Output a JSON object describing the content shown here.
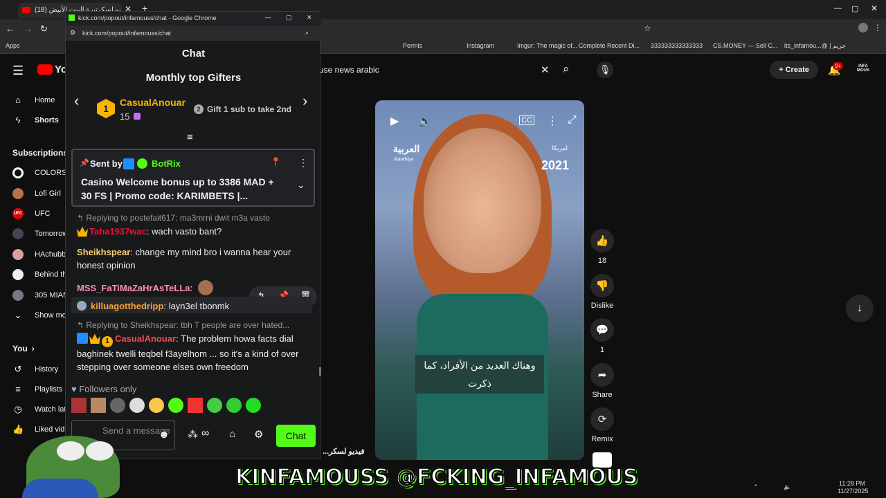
{
  "browser": {
    "tab_title": "(18) فيديو لسكرتيرة البيت الأبيض",
    "bookmarks": [
      "Apps",
      "Permis",
      "Instagram",
      "Imgur: The magic of...",
      "Complete Recent Di...",
      "333333333333333",
      "CS.MONEY — Sell C...",
      "its_infamou...@ | جريم"
    ]
  },
  "youtube": {
    "logo": "You",
    "search_value": "use news arabic",
    "create_label": "Create",
    "notif_count": "9+",
    "sidebar": {
      "top": [
        {
          "label": "Home",
          "icon": "home-icon"
        },
        {
          "label": "Shorts",
          "icon": "shorts-icon"
        }
      ],
      "subscriptions_title": "Subscriptions",
      "subscriptions": [
        "COLORS",
        "Lofi Girl",
        "UFC",
        "Tomorrow",
        "HAchubb",
        "Behind th",
        "305 MIAN",
        "Show mo"
      ],
      "you_title": "You",
      "you_items": [
        "History",
        "Playlists",
        "Watch lat",
        "Liked vid"
      ]
    },
    "video": {
      "brand": "العربية",
      "brand_sub": "alarabiya",
      "country": "امريكا",
      "year": "2021",
      "caption": "وهناك العديد من الأفراد، كما ذكرت",
      "bottom_title": "...فيديو لسكر"
    },
    "actions": {
      "likes": "18",
      "dislike": "Dislike",
      "comments": "1",
      "share": "Share",
      "remix": "Remix"
    }
  },
  "chat_window": {
    "window_title": "kick.com/popout/infamouss/chat - Google Chrome",
    "url": "kick.com/popout/infamouss/chat",
    "heading": "Chat",
    "gifters_title": "Monthly top Gifters",
    "top_gifter": {
      "rank": "1",
      "name": "CasualAnouar",
      "count": "15"
    },
    "second_hint": {
      "rank": "2",
      "text": "Gift 1 sub to take 2nd"
    },
    "pinned": {
      "sent_by": "Sent by",
      "sender": "BotRix",
      "text": "Casino Welcome bonus up to 3386 MAD + 30 FS | Promo code: KARIMBETS |..."
    },
    "messages": [
      {
        "reply": "Replying to postefait617: ma3mrni dwit m3a vasto",
        "user": "Taha1937wac",
        "text": ": wach vasto bant?"
      },
      {
        "user": "Sheikhspear",
        "text": ": change my mind bro i wanna hear your honest opinion"
      },
      {
        "user": "MSS_FaTiMaZaHrAsTeLLa",
        "text": ":"
      },
      {
        "user": "killuagotthedripp",
        "text": ": layn3el tbonmk"
      },
      {
        "reply": "Replying to Sheikhspear: tbh T people are over hated...",
        "user": "CasualAnouar",
        "text": ": The problem howa     facts dial baghinek twelli teqbel f3ayelhom ... so it's a kind of over stepping over someone elses own freedom"
      }
    ],
    "followers_only": "Followers only",
    "input_placeholder": "Send a message",
    "chat_button": "Chat"
  },
  "overlay": {
    "text": "KINFAMOUSS @FCKING_INFAMOUS"
  },
  "tray": {
    "time": "11:28 PM",
    "date": "11/27/2025"
  },
  "colors": {
    "kick_green": "#53fc18",
    "accent_gold": "#f7b500",
    "yt_red": "#ff0000"
  }
}
